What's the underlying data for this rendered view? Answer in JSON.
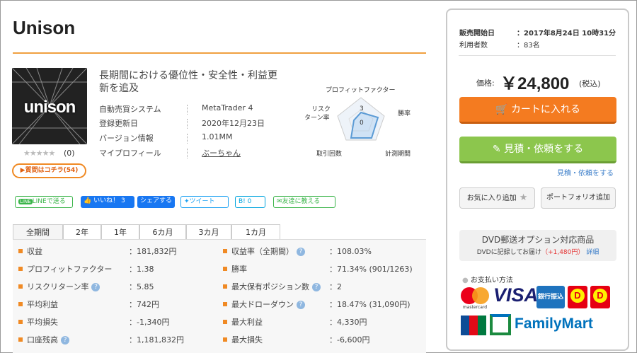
{
  "product": {
    "title": "Unison",
    "description": "長期間における優位性・安全性・利益更新を追及",
    "thumb_text": "unison",
    "rating_stars": "★★★★★",
    "rating_count": "(0)",
    "qa_button": "質問はコチラ(54)"
  },
  "info_rows": [
    {
      "key": "自動売買システム",
      "value": "MetaTrader 4"
    },
    {
      "key": "登録更新日",
      "value": "2020年12月23日"
    },
    {
      "key": "バージョン情報",
      "value": "1.01MM"
    },
    {
      "key": "マイプロフィール",
      "value": "ぶーちゃん"
    }
  ],
  "radar": {
    "labels": {
      "top": "プロフィットファクター",
      "right_top": "勝率",
      "right_bottom": "計測期間",
      "bottom_left": "取引回数",
      "left": "リスク\nターン率"
    },
    "scale_max": "3",
    "scale_min": "0"
  },
  "social": {
    "line": "LINEで送る",
    "like": "いいね！ 3",
    "share": "シェアする",
    "tweet": "ツイート",
    "hatena": "B! 0",
    "tell_friend": "友達に教える"
  },
  "tabs": [
    "全期間",
    "2年",
    "1年",
    "6カ月",
    "3カ月",
    "1カ月"
  ],
  "stats_left": [
    {
      "label": "収益",
      "value": "：181,832円",
      "help": false
    },
    {
      "label": "プロフィットファクター",
      "value": "：1.38",
      "help": false
    },
    {
      "label": "リスクリターン率",
      "value": "：5.85",
      "help": true
    },
    {
      "label": "平均利益",
      "value": "：742円",
      "help": false
    },
    {
      "label": "平均損失",
      "value": "：-1,340円",
      "help": false
    },
    {
      "label": "口座残高",
      "value": "：1,181,832円",
      "help": true
    }
  ],
  "stats_right": [
    {
      "label": "収益率（全期間）",
      "value": "：108.03%",
      "help": true
    },
    {
      "label": "勝率",
      "value": "：71.34% (901/1263)",
      "help": false
    },
    {
      "label": "最大保有ポジション数",
      "value": "：2",
      "help": true
    },
    {
      "label": "最大ドローダウン",
      "value": "：18.47% (31,090円)",
      "help": true
    },
    {
      "label": "最大利益",
      "value": "：4,330円",
      "help": false
    },
    {
      "label": "最大損失",
      "value": "：-6,600円",
      "help": false
    }
  ],
  "panel": {
    "sale_start_label": "販売開始日",
    "sale_start_value": "：2017年8月24日 10時31分",
    "users_label": "利用者数",
    "users_value": "：83名",
    "price_label": "価格:",
    "price": "￥24,800",
    "tax": "(税込)",
    "cart_button": "カートに入れる",
    "quote_button": "見積・依頼をする",
    "quote_link": "見積・依頼をする",
    "favorite_button": "お気に入り追加",
    "portfolio_button": "ポートフォリオ追加",
    "dvd_title": "DVD郵送オプション対応商品",
    "dvd_note": "DVDに記録してお届け",
    "dvd_price": "（+1,480円）",
    "dvd_detail": "詳細",
    "payment_label": "お支払い方法",
    "pay": {
      "visa": "VISA",
      "bank": "銀行振込",
      "familymart": "FamilyMart",
      "jcb": "JCB",
      "mastercard": "mastercard"
    }
  },
  "colors": {
    "accent": "#f47b20",
    "green": "#8cc64d",
    "link": "#3a7dc9"
  }
}
